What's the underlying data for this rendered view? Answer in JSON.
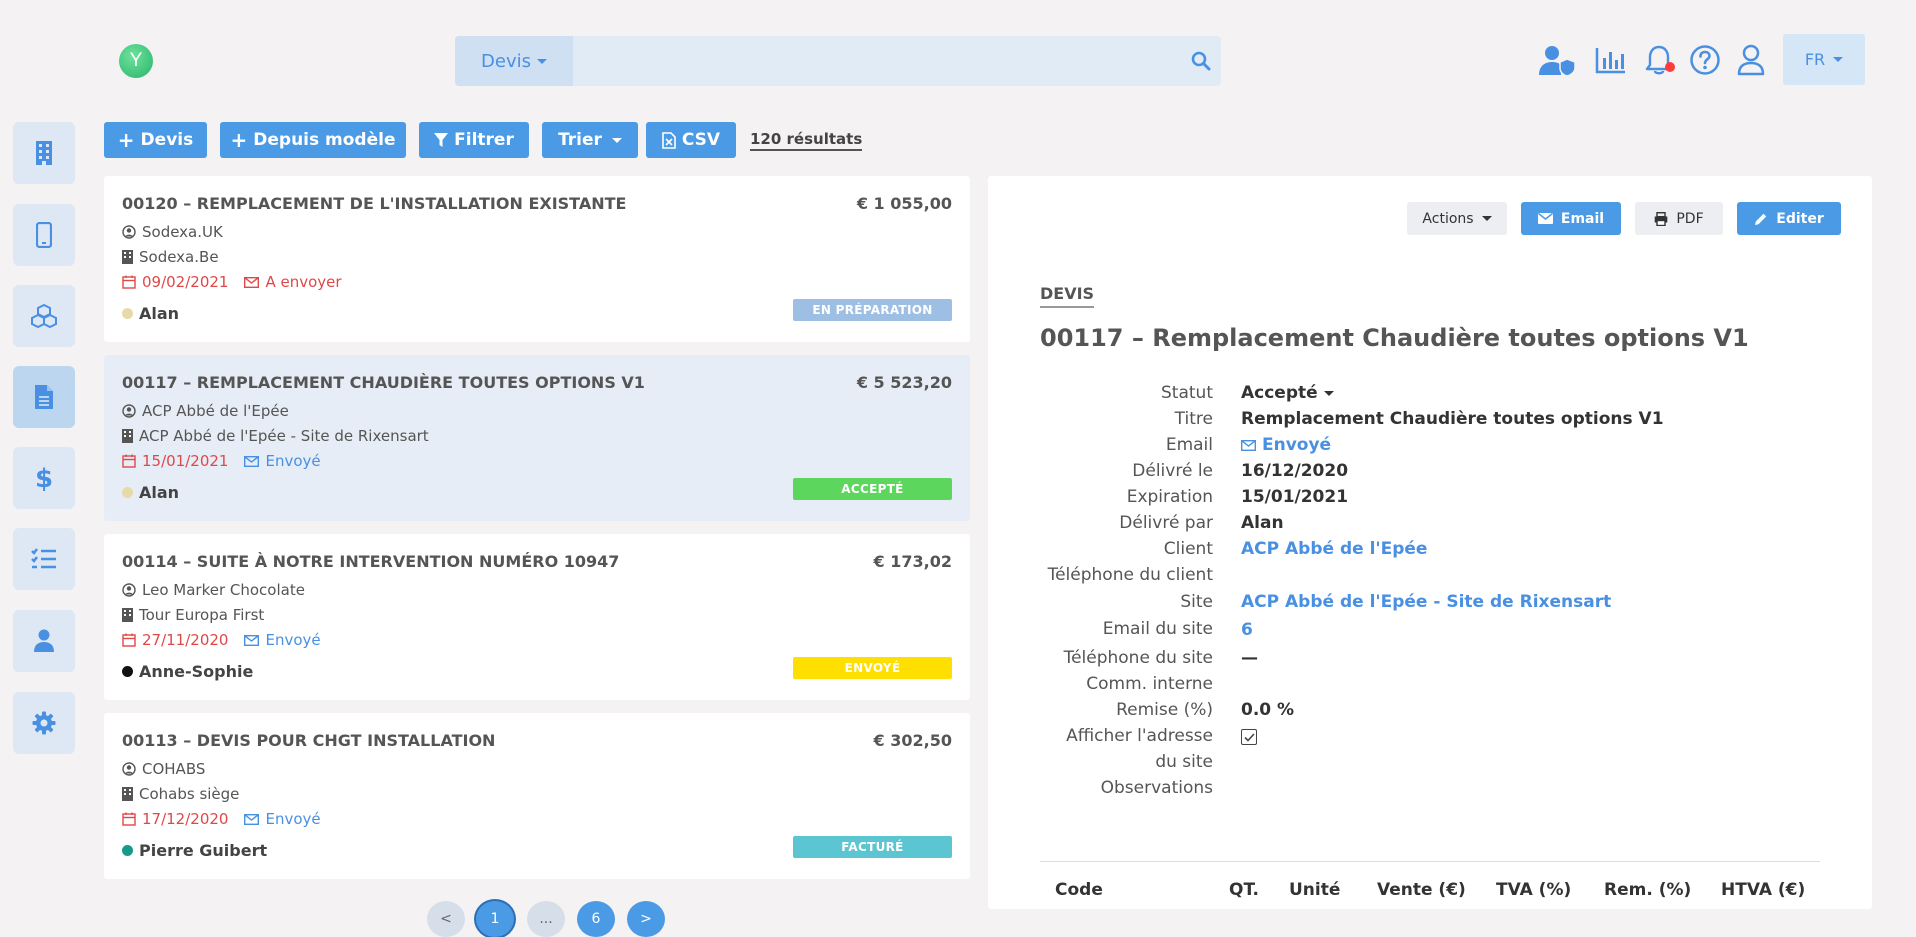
{
  "logo": {
    "letter": "Y"
  },
  "search": {
    "type_label": "Devis",
    "placeholder": ""
  },
  "lang": {
    "label": "FR"
  },
  "toolbar": {
    "new_quote": "Devis",
    "from_template": "Depuis modèle",
    "filter": "Filtrer",
    "sort": "Trier",
    "csv": "CSV",
    "results": "120 résultats"
  },
  "cards": [
    {
      "title": "00120 – REMPLACEMENT DE L'INSTALLATION EXISTANTE",
      "amount": "€ 1 055,00",
      "client": "Sodexa.UK",
      "site": "Sodexa.Be",
      "date": "09/02/2021",
      "mail_status": "A envoyer",
      "user": "Alan",
      "badge": "EN PRÉPARATION"
    },
    {
      "title": "00117 – REMPLACEMENT CHAUDIÈRE TOUTES OPTIONS V1",
      "amount": "€ 5 523,20",
      "client": "ACP Abbé de l'Epée",
      "site": "ACP Abbé de l'Epée - Site de Rixensart",
      "date": "15/01/2021",
      "mail_status": "Envoyé",
      "user": "Alan",
      "badge": "ACCEPTÉ"
    },
    {
      "title": "00114 – SUITE À NOTRE INTERVENTION NUMÉRO 10947",
      "amount": "€ 173,02",
      "client": "Leo Marker Chocolate",
      "site": "Tour Europa First",
      "date": "27/11/2020",
      "mail_status": "Envoyé",
      "user": "Anne-Sophie",
      "badge": "ENVOYÉ"
    },
    {
      "title": "00113 – DEVIS POUR CHGT INSTALLATION",
      "amount": "€ 302,50",
      "client": "COHABS",
      "site": "Cohabs siège",
      "date": "17/12/2020",
      "mail_status": "Envoyé",
      "user": "Pierre Guibert",
      "badge": "FACTURÉ"
    }
  ],
  "colors": {
    "badge_preparation": "#9dbfe4",
    "badge_accepted": "#5cd65c",
    "badge_sent": "#ffdf00",
    "badge_invoiced": "#5bc5d1",
    "dot_alan": "#e8d9a8",
    "dot_anne": "#111111",
    "dot_pierre": "#159a8a",
    "accent": "#4a9ae6"
  },
  "pagination": {
    "prev": "<",
    "current": "1",
    "ellipsis": "...",
    "last": "6",
    "next": ">"
  },
  "detail": {
    "actions": "Actions",
    "email_btn": "Email",
    "pdf_btn": "PDF",
    "edit_btn": "Editer",
    "kind": "DEVIS",
    "title": "00117 – Remplacement Chaudière toutes options V1",
    "labels": {
      "status": "Statut",
      "title": "Titre",
      "email": "Email",
      "issued_on": "Délivré le",
      "expiration": "Expiration",
      "issued_by": "Délivré par",
      "client": "Client",
      "client_phone": "Téléphone du client",
      "site": "Site",
      "site_email": "Email du site",
      "site_phone": "Téléphone du site",
      "internal_comm": "Comm. interne",
      "discount": "Remise (%)",
      "show_address_1": "Afficher l'adresse",
      "show_address_2": "du site",
      "observations": "Observations"
    },
    "values": {
      "status": "Accepté",
      "title": "Remplacement Chaudière toutes options V1",
      "email": "Envoyé",
      "issued_on": "16/12/2020",
      "expiration": "15/01/2021",
      "issued_by": "Alan",
      "client": "ACP Abbé de l'Epée",
      "site": "ACP Abbé de l'Epée - Site de Rixensart",
      "site_email": "6",
      "site_phone": "—",
      "discount": "0.0 %"
    },
    "table_headers": [
      "Code",
      "QT.",
      "Unité",
      "Vente (€)",
      "TVA (%)",
      "Rem. (%)",
      "HTVA (€)"
    ]
  }
}
